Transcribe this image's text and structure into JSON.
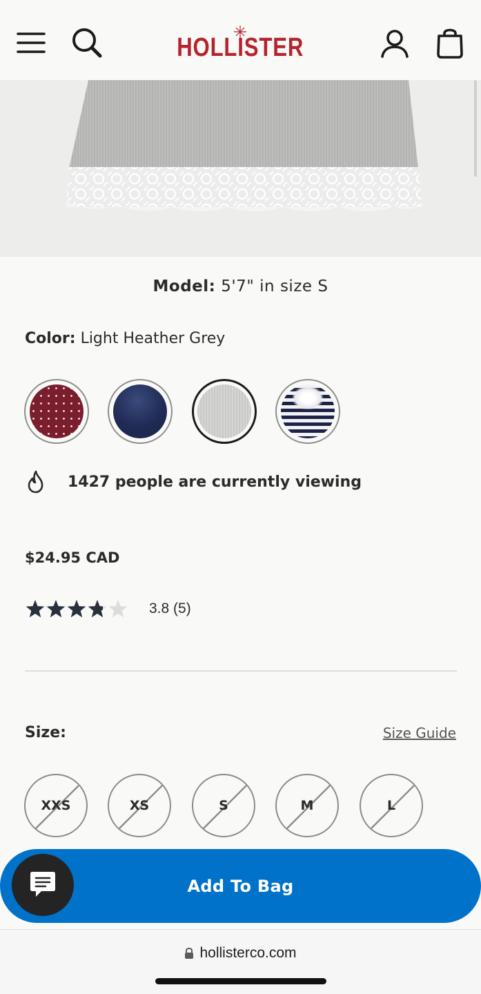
{
  "header": {
    "brand": "HOLLISTER",
    "icons": [
      "menu-icon",
      "search-icon",
      "account-icon",
      "bag-icon"
    ]
  },
  "product": {
    "model_label": "Model:",
    "model_value": "5'7\" in size S",
    "color_label": "Color:",
    "color_value": "Light Heather Grey",
    "swatches": [
      {
        "name": "burgundy polka dot",
        "selected": false
      },
      {
        "name": "navy",
        "selected": false
      },
      {
        "name": "light heather grey",
        "selected": true
      },
      {
        "name": "navy white stripe",
        "selected": false
      }
    ],
    "viewing_text": "1427 people are currently viewing",
    "price": "$24.95 CAD",
    "rating_value": 3.8,
    "rating_max": 5,
    "rating_text": "3.8 (5)",
    "size_label": "Size:",
    "size_guide": "Size Guide",
    "sizes": [
      {
        "label": "XXS",
        "available": false
      },
      {
        "label": "XS",
        "available": false
      },
      {
        "label": "S",
        "available": false
      },
      {
        "label": "M",
        "available": false
      },
      {
        "label": "L",
        "available": false
      }
    ]
  },
  "cta": {
    "add_to_bag": "Add To Bag"
  },
  "browser": {
    "url": "hollisterco.com"
  },
  "colors": {
    "brand_red": "#b5242c",
    "cta_blue": "#0072c9",
    "chat_dark": "#242424"
  }
}
